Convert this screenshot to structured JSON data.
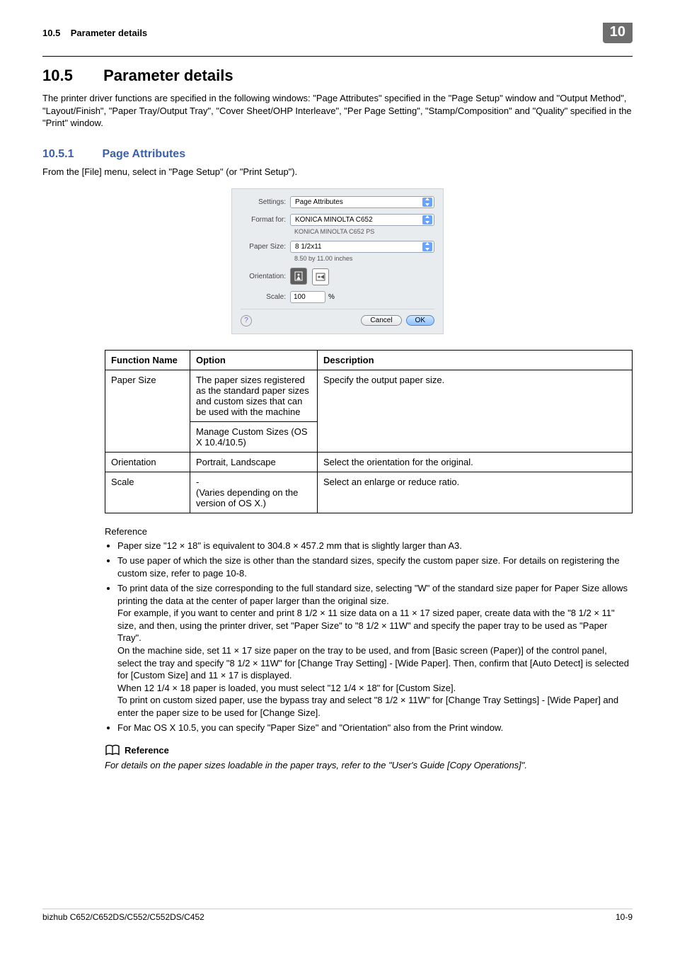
{
  "header": {
    "breadcrumb_section": "10.5",
    "breadcrumb_title": "Parameter details",
    "chapter_badge": "10"
  },
  "section": {
    "number": "10.5",
    "title": "Parameter details",
    "intro": "The printer driver functions are specified in the following windows: \"Page Attributes\" specified in the \"Page Setup\" window and \"Output Method\", \"Layout/Finish\", \"Paper Tray/Output Tray\", \"Cover Sheet/OHP Interleave\", \"Per Page Setting\", \"Stamp/Composition\" and \"Quality\" specified in the \"Print\" window."
  },
  "subsection": {
    "number": "10.5.1",
    "title": "Page Attributes",
    "lead": "From the [File] menu, select in \"Page Setup\" (or \"Print Setup\")."
  },
  "dialog": {
    "settings_label": "Settings:",
    "settings_value": "Page Attributes",
    "format_label": "Format for:",
    "format_value": "KONICA MINOLTA C652",
    "format_sub": "KONICA MINOLTA C652 PS",
    "papersize_label": "Paper Size:",
    "papersize_value": "8 1/2x11",
    "papersize_sub": "8.50 by 11.00 inches",
    "orientation_label": "Orientation:",
    "scale_label": "Scale:",
    "scale_value": "100",
    "scale_unit": "%",
    "cancel": "Cancel",
    "ok": "OK"
  },
  "table": {
    "head": {
      "fn": "Function Name",
      "opt": "Option",
      "desc": "Description"
    },
    "rows": [
      {
        "fn": "Paper Size",
        "opt1": "The paper sizes registered as the standard paper sizes and custom sizes that can be used with the machine",
        "opt2": "Manage Custom Sizes (OS X 10.4/10.5)",
        "desc": "Specify the output paper size."
      },
      {
        "fn": "Orientation",
        "opt1": "Portrait, Landscape",
        "desc": "Select the orientation for the original."
      },
      {
        "fn": "Scale",
        "opt1": "-\n(Varies depending on the version of OS X.)",
        "desc": "Select an enlarge or reduce ratio."
      }
    ]
  },
  "reference_label": "Reference",
  "bullets": [
    "Paper size \"12 × 18\" is equivalent to 304.8 × 457.2 mm that is slightly larger than A3.",
    "To use paper of which the size is other than the standard sizes, specify the custom paper size. For details on registering the custom size, refer to page 10-8.",
    "To print data of the size corresponding to the full standard size, selecting \"W\" of the standard size paper for Paper Size allows printing the data at the center of paper larger than the original size.\nFor example, if you want to center and print 8 1/2 × 11 size data on a 11 × 17 sized paper, create data with the \"8 1/2 × 11\" size, and then, using the printer driver, set \"Paper Size\" to \"8 1/2 × 11W\" and specify the paper tray to be used as \"Paper Tray\".\nOn the machine side, set 11 × 17 size paper on the tray to be used, and from [Basic screen (Paper)] of the control panel, select the tray and specify \"8 1/2 × 11W\" for [Change Tray Setting] - [Wide Paper]. Then, confirm that [Auto Detect] is selected for [Custom Size] and 11 × 17 is displayed.\n When 12 1/4 × 18 paper is loaded, you must select \"12 1/4 × 18\" for [Custom Size].\nTo print on custom sized paper, use the bypass tray and select \"8 1/2 × 11W\" for [Change Tray Settings] - [Wide Paper] and enter the paper size to be used for [Change Size].",
    "For Mac OS X 10.5, you can specify \"Paper Size\" and \"Orientation\" also from the Print window."
  ],
  "ref2_title": "Reference",
  "ref2_text": "For details on the paper sizes loadable in the paper trays, refer to the \"User's Guide [Copy Operations]\".",
  "footer": {
    "left": "bizhub C652/C652DS/C552/C552DS/C452",
    "right": "10-9"
  }
}
